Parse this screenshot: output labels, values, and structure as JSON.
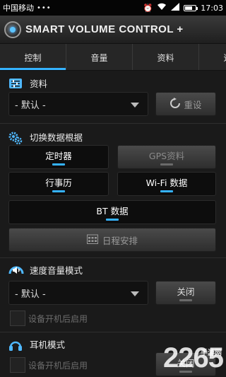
{
  "status_bar": {
    "carrier": "中国移动",
    "dots": "•••",
    "time": "17:03"
  },
  "app": {
    "title": "SMART VOLUME CONTROL +"
  },
  "tabs": [
    {
      "label": "控制",
      "active": true
    },
    {
      "label": "音量",
      "active": false
    },
    {
      "label": "资料",
      "active": false
    },
    {
      "label": "速度",
      "active": false
    }
  ],
  "profile": {
    "title": "资料",
    "dropdown_value": "- 默认 -",
    "reset_label": "重设"
  },
  "switch": {
    "title": "切换数据根据",
    "timer": {
      "label": "定时器",
      "on": true
    },
    "gps": {
      "label": "GPS资料",
      "on": false
    },
    "calendar": {
      "label": "行事历",
      "on": true
    },
    "wifi": {
      "label": "Wi-Fi 数据",
      "on": true
    },
    "bt": {
      "label": "BT 数据",
      "on": true
    },
    "schedule_label": "日程安排"
  },
  "speed": {
    "title": "速度音量模式",
    "dropdown_value": "- 默认 -",
    "toggle_label": "关闭",
    "checkbox_label": "设备开机后启用"
  },
  "headset": {
    "title": "耳机模式",
    "checkbox_label": "设备开机后启用",
    "toggle_label": "关闭"
  },
  "watermark": {
    "text": "2265",
    "small": "手游网"
  },
  "colors": {
    "accent": "#35b3ff",
    "background": "#1a1a1a"
  }
}
